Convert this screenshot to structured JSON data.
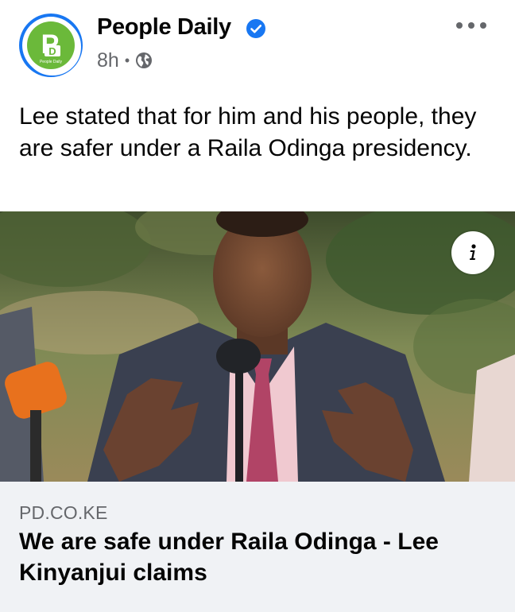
{
  "post": {
    "page_name": "People Daily",
    "time": "8h",
    "separator": "•",
    "text": "Lee stated that for him and his people, they are safer under a Raila Odinga presidency.",
    "avatar_logo_text": "PD",
    "avatar_logo_subtext": "People Daily"
  },
  "link_preview": {
    "domain": "PD.CO.KE",
    "title": "We are safe under Raila Odinga - Lee Kinyanjui claims"
  },
  "icons": {
    "verified": "verified-badge-icon",
    "audience": "globe-icon",
    "more": "more-options-icon",
    "info": "info-icon"
  },
  "colors": {
    "brand_blue": "#1877f2",
    "logo_green": "#6bb93a",
    "secondary_text": "#65676b",
    "link_box_bg": "#f0f2f5"
  }
}
